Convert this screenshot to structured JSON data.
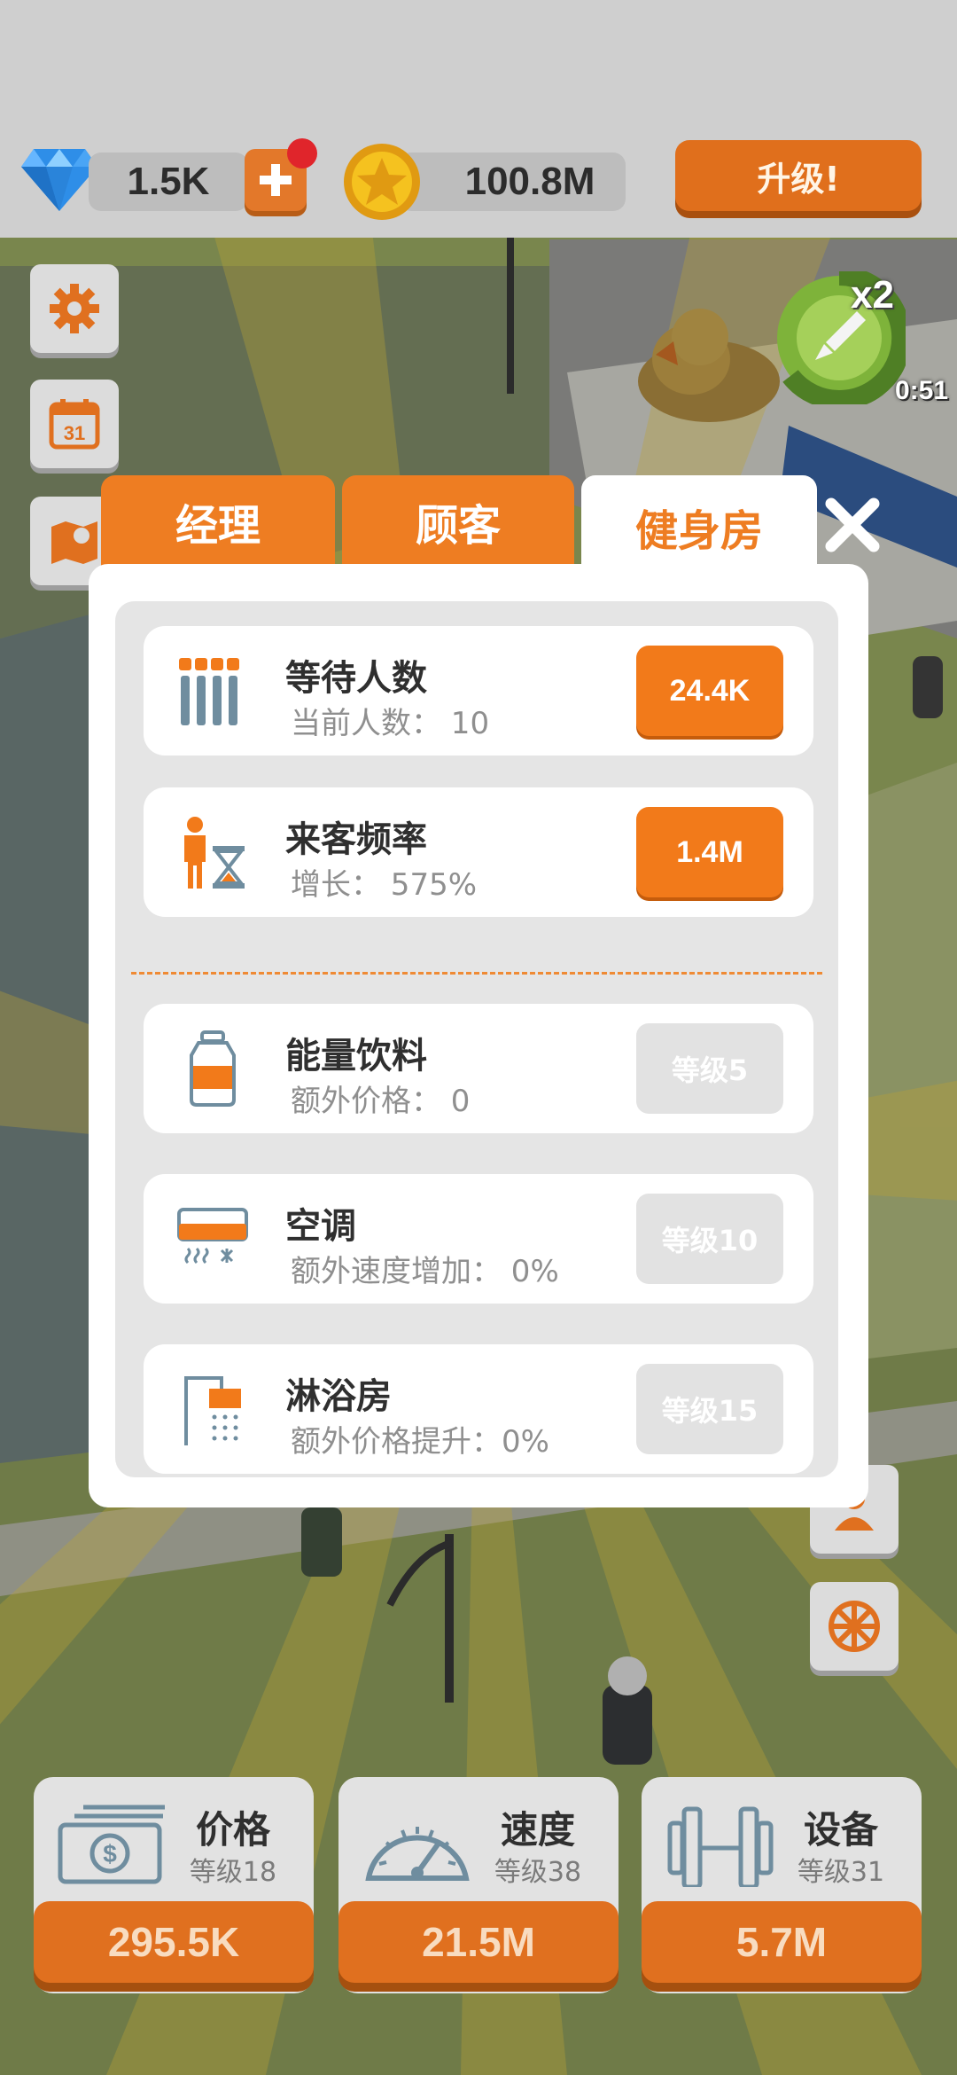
{
  "currency": {
    "gems": "1.5K",
    "coins": "100.8M"
  },
  "header": {
    "upgrade_label": "升级!"
  },
  "boost": {
    "multiplier": "x2",
    "timer": "0:51"
  },
  "side_buttons": {
    "calendar_day": "31"
  },
  "tabs": [
    {
      "label": "经理"
    },
    {
      "label": "顾客"
    },
    {
      "label": "健身房"
    }
  ],
  "active_tab": "健身房",
  "panel": {
    "items": [
      {
        "title": "等待人数",
        "subtitle": "当前人数：  10",
        "action": "24.4K",
        "icon": "people-queue-icon"
      },
      {
        "title": "来客频率",
        "subtitle": "增长：  575%",
        "action": "1.4M",
        "icon": "person-hourglass-icon"
      },
      {
        "title": "能量饮料",
        "subtitle": "额外价格：  0",
        "action": "等级5",
        "icon": "drink-bottle-icon"
      },
      {
        "title": "空调",
        "subtitle": "额外速度增加：  0%",
        "action": "等级10",
        "icon": "air-conditioner-icon"
      },
      {
        "title": "淋浴房",
        "subtitle": "额外价格提升：0%",
        "action": "等级15",
        "icon": "shower-icon"
      }
    ]
  },
  "upgrades": [
    {
      "title": "价格",
      "level": "等级18",
      "cost": "295.5K",
      "icon": "money-icon"
    },
    {
      "title": "速度",
      "level": "等级38",
      "cost": "21.5M",
      "icon": "speedometer-icon"
    },
    {
      "title": "设备",
      "level": "等级31",
      "cost": "5.7M",
      "icon": "dumbbell-icon"
    }
  ],
  "colors": {
    "accent": "#ee7d22",
    "button_dark": "#e0701f",
    "panel": "#ffffff"
  }
}
